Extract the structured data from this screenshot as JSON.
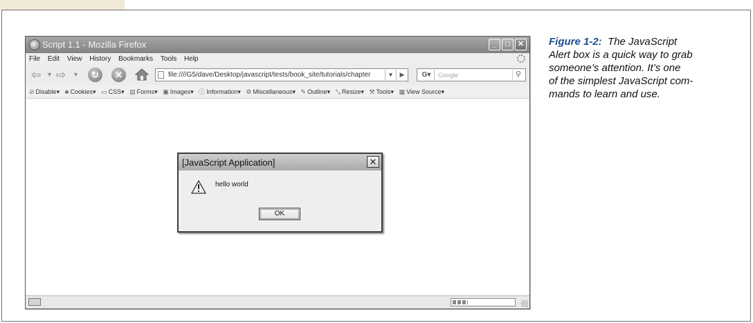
{
  "browser": {
    "title": "Script 1.1 - Mozilla Firefox",
    "menu": [
      "File",
      "Edit",
      "View",
      "History",
      "Bookmarks",
      "Tools",
      "Help"
    ],
    "url": "file:////G5/dave/Desktop/javascript/tests/book_site/tutorials/chapter",
    "search_placeholder": "Google",
    "search_engine_glyph": "G",
    "webdev_toolbar": [
      "Disable",
      "Cookies",
      "CSS",
      "Forms",
      "Images",
      "Information",
      "Miscellaneous",
      "Outline",
      "Resize",
      "Tools",
      "View Source"
    ],
    "window_buttons": [
      "minimize",
      "maximize",
      "close"
    ]
  },
  "dialog": {
    "title": "[JavaScript Application]",
    "message": "hello world",
    "ok_label": "OK",
    "icon": "warning-icon"
  },
  "caption": {
    "label": "Figure 1-2:",
    "lines": [
      "The JavaScript",
      "Alert box is a quick way to grab",
      "someone’s attention. It’s one",
      "of the simplest JavaScript com-",
      "mands to learn and use."
    ]
  }
}
